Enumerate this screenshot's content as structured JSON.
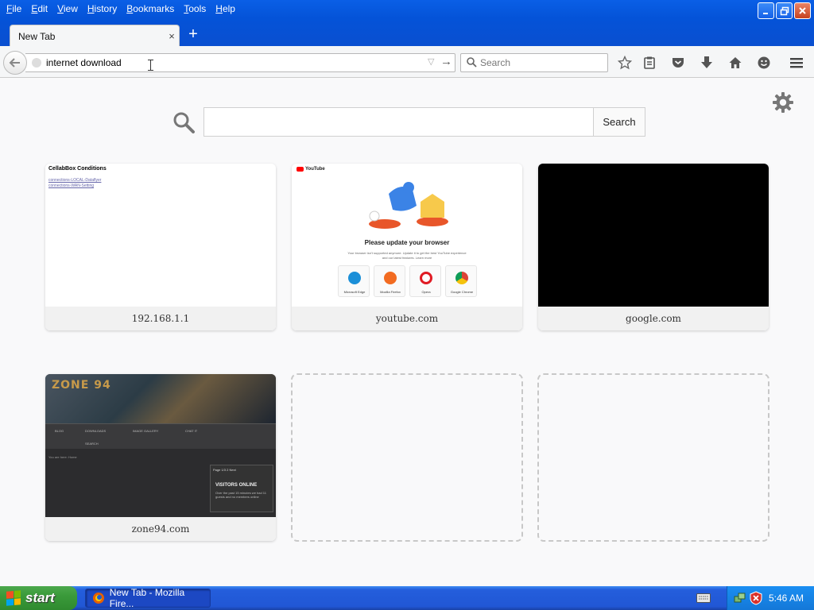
{
  "menubar": {
    "items": [
      "File",
      "Edit",
      "View",
      "History",
      "Bookmarks",
      "Tools",
      "Help"
    ]
  },
  "tab": {
    "title": "New Tab",
    "close_glyph": "×",
    "new_tab_glyph": "+"
  },
  "urlbar": {
    "value": "internet download"
  },
  "searchbar": {
    "placeholder": "Search"
  },
  "newtab_search": {
    "button_label": "Search"
  },
  "tiles": [
    {
      "label": "192.168.1.1",
      "thumb_title": "CellabBox Conditions",
      "thumb_links": [
        "connections-LOCAL-Dataflyer",
        "connections-WAN-Setting"
      ]
    },
    {
      "label": "youtube.com",
      "thumb_logo": "YouTube",
      "thumb_message": "Please update your browser",
      "thumb_sub1": "Your browser isn't supported anymore. Update it to get the best YouTube experience",
      "thumb_sub2": "and our latest features. Learn more",
      "browsers": [
        "Microsoft Edge",
        "Mozilla Firefox",
        "Opera",
        "Google Chrome"
      ]
    },
    {
      "label": "google.com"
    },
    {
      "label": "zone94.com",
      "thumb_logo": "ZONE 94",
      "nav": [
        "BLOG",
        "DOWNLOADS",
        "IMAGE GALLERY",
        "CHAT IT",
        "SEARCH"
      ],
      "crumb": "You are here: Home",
      "box_head": "Page 1/3 2 Next",
      "visitors_title": "VISITORS ONLINE",
      "visitors_text": "Over the past 15 minutes we had 11 guests and no members online"
    }
  ],
  "taskbar": {
    "start_label": "start",
    "task_label": "New Tab - Mozilla Fire...",
    "clock": "5:46 AM"
  },
  "colors": {
    "titlebar_blue": "#0453d8",
    "taskbar_blue": "#245edc",
    "start_green": "#3a9a3a",
    "tray_blue": "#1478d8"
  }
}
